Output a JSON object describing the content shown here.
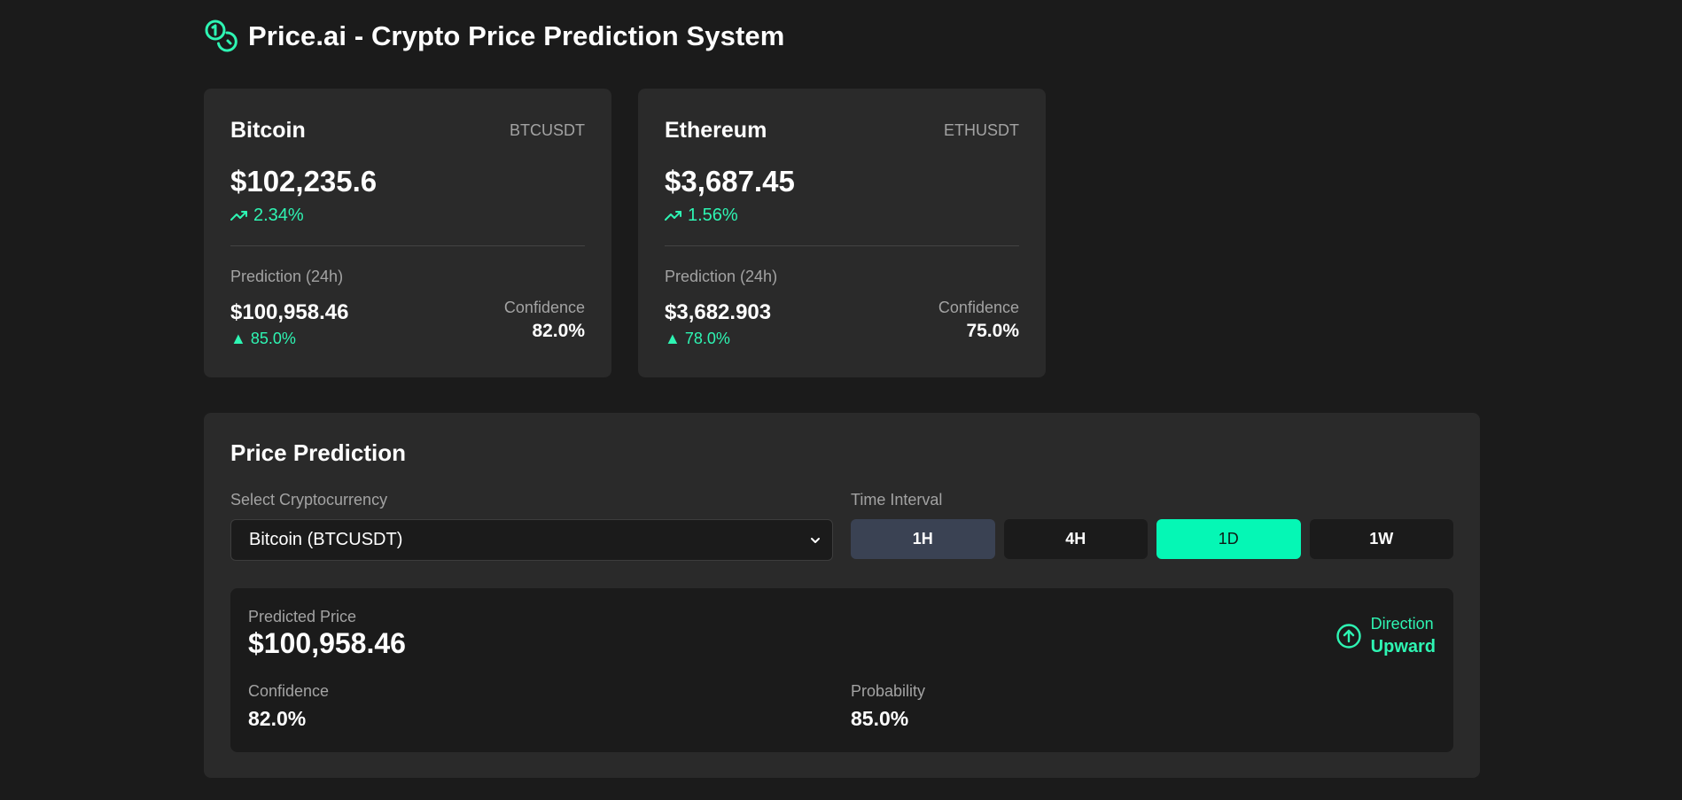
{
  "header": {
    "logo_icon": "coins-icon",
    "title": "Price.ai - Crypto Price Prediction System"
  },
  "colors": {
    "background": "#1b1b1b",
    "card": "#2a2a2a",
    "accent": "#05f7b5",
    "positive": "#2ef5b3",
    "muted": "#a3a3a3"
  },
  "cards": [
    {
      "name": "Bitcoin",
      "symbol": "BTCUSDT",
      "price": "$102,235.6",
      "change_icon": "trending-up-icon",
      "change": "2.34%",
      "prediction_label": "Prediction (24h)",
      "prediction_price": "$100,958.46",
      "prediction_probability": "▲ 85.0%",
      "confidence_label": "Confidence",
      "confidence": "82.0%"
    },
    {
      "name": "Ethereum",
      "symbol": "ETHUSDT",
      "price": "$3,687.45",
      "change_icon": "trending-up-icon",
      "change": "1.56%",
      "prediction_label": "Prediction (24h)",
      "prediction_price": "$3,682.903",
      "prediction_probability": "▲ 78.0%",
      "confidence_label": "Confidence",
      "confidence": "75.0%"
    }
  ],
  "prediction_panel": {
    "title": "Price Prediction",
    "select_label": "Select Cryptocurrency",
    "selected_crypto": "Bitcoin (BTCUSDT)",
    "interval_label": "Time Interval",
    "intervals": [
      "1H",
      "4H",
      "1D",
      "1W"
    ],
    "active_interval": "1D",
    "result": {
      "predicted_price_label": "Predicted Price",
      "predicted_price": "$100,958.46",
      "direction_icon": "arrow-up-circle-icon",
      "direction_label": "Direction",
      "direction": "Upward",
      "confidence_label": "Confidence",
      "confidence": "82.0%",
      "probability_label": "Probability",
      "probability": "85.0%"
    }
  }
}
